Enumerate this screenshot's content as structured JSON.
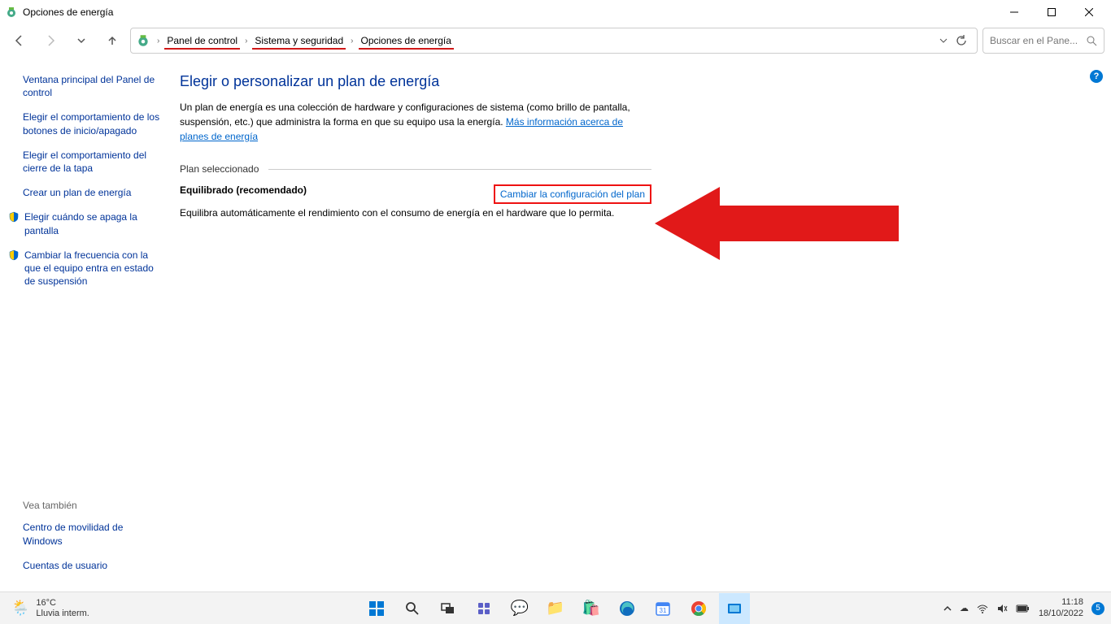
{
  "window": {
    "title": "Opciones de energía"
  },
  "breadcrumb": {
    "items": [
      "Panel de control",
      "Sistema y seguridad",
      "Opciones de energía"
    ]
  },
  "search": {
    "placeholder": "Buscar en el Pane..."
  },
  "sidebar": {
    "links": [
      "Ventana principal del Panel de control",
      "Elegir el comportamiento de los botones de inicio/apagado",
      "Elegir el comportamiento del cierre de la tapa",
      "Crear un plan de energía",
      "Elegir cuándo se apaga la pantalla",
      "Cambiar la frecuencia con la que el equipo entra en estado de suspensión"
    ],
    "see_also_title": "Vea también",
    "see_also": [
      "Centro de movilidad de Windows",
      "Cuentas de usuario"
    ]
  },
  "main": {
    "heading": "Elegir o personalizar un plan de energía",
    "description_pre": "Un plan de energía es una colección de hardware y configuraciones de sistema (como brillo de pantalla, suspensión, etc.) que administra la forma en que su equipo usa la energía. ",
    "description_link": "Más información acerca de planes de energía",
    "plan_section_title": "Plan seleccionado",
    "plan_name": "Equilibrado (recomendado)",
    "plan_change_link": "Cambiar la configuración del plan",
    "plan_desc": "Equilibra automáticamente el rendimiento con el consumo de energía en el hardware que lo permita."
  },
  "taskbar": {
    "weather_temp": "16°C",
    "weather_desc": "Lluvia interm.",
    "time": "11:18",
    "date": "18/10/2022",
    "notif_count": "5"
  }
}
